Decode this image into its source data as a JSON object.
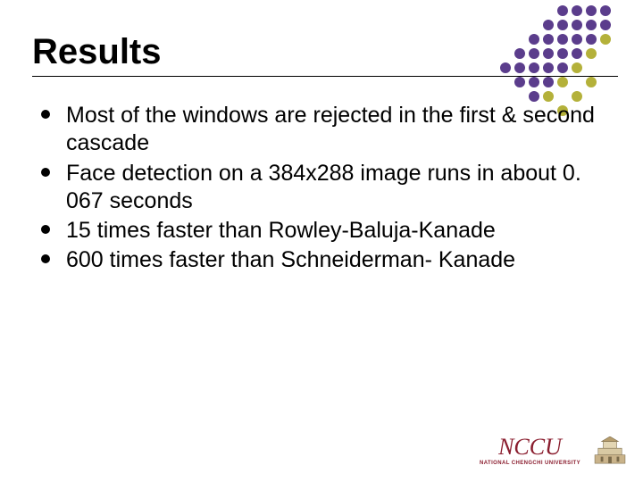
{
  "title": "Results",
  "bullets": [
    "Most of the windows are rejected in the first & second cascade",
    "Face detection on a 384x288 image runs in about 0. 067 seconds",
    "15 times faster than Rowley-Baluja-Kanade",
    "600 times faster than Schneiderman- Kanade"
  ],
  "footer": {
    "logo_text": "NCCU",
    "logo_sub": "NATIONAL CHENGCHI UNIVERSITY"
  },
  "dot_colors": {
    "purple": "#5b3d8c",
    "olive": "#b4b13a",
    "empty": "transparent"
  },
  "dot_pattern": [
    [
      "empty",
      "empty",
      "empty",
      "empty",
      "purple",
      "purple",
      "purple",
      "purple"
    ],
    [
      "empty",
      "empty",
      "empty",
      "purple",
      "purple",
      "purple",
      "purple",
      "purple"
    ],
    [
      "empty",
      "empty",
      "purple",
      "purple",
      "purple",
      "purple",
      "purple",
      "olive"
    ],
    [
      "empty",
      "purple",
      "purple",
      "purple",
      "purple",
      "purple",
      "olive",
      "empty"
    ],
    [
      "purple",
      "purple",
      "purple",
      "purple",
      "purple",
      "olive",
      "empty",
      "empty"
    ],
    [
      "empty",
      "purple",
      "purple",
      "purple",
      "olive",
      "empty",
      "olive",
      "empty"
    ],
    [
      "empty",
      "empty",
      "purple",
      "olive",
      "empty",
      "olive",
      "empty",
      "empty"
    ],
    [
      "empty",
      "empty",
      "empty",
      "empty",
      "olive",
      "empty",
      "empty",
      "empty"
    ]
  ]
}
